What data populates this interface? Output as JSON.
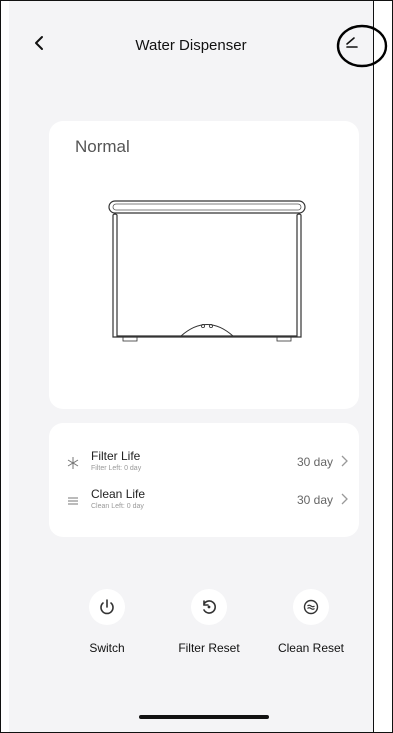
{
  "header": {
    "title": "Water Dispenser"
  },
  "status": {
    "text": "Normal"
  },
  "life": [
    {
      "name": "Filter Life",
      "sub": "Filter Left: 0 day",
      "value": "30 day",
      "icon": "filter-icon"
    },
    {
      "name": "Clean Life",
      "sub": "Clean Left: 0 day",
      "value": "30 day",
      "icon": "clean-icon"
    }
  ],
  "controls": [
    {
      "label": "Switch",
      "icon": "power-icon"
    },
    {
      "label": "Filter Reset",
      "icon": "reset-icon"
    },
    {
      "label": "Clean Reset",
      "icon": "clean-reset-icon"
    }
  ],
  "colors": {
    "background": "#f4f4f6",
    "card": "#ffffff",
    "text": "#111111",
    "muted": "#999999"
  }
}
